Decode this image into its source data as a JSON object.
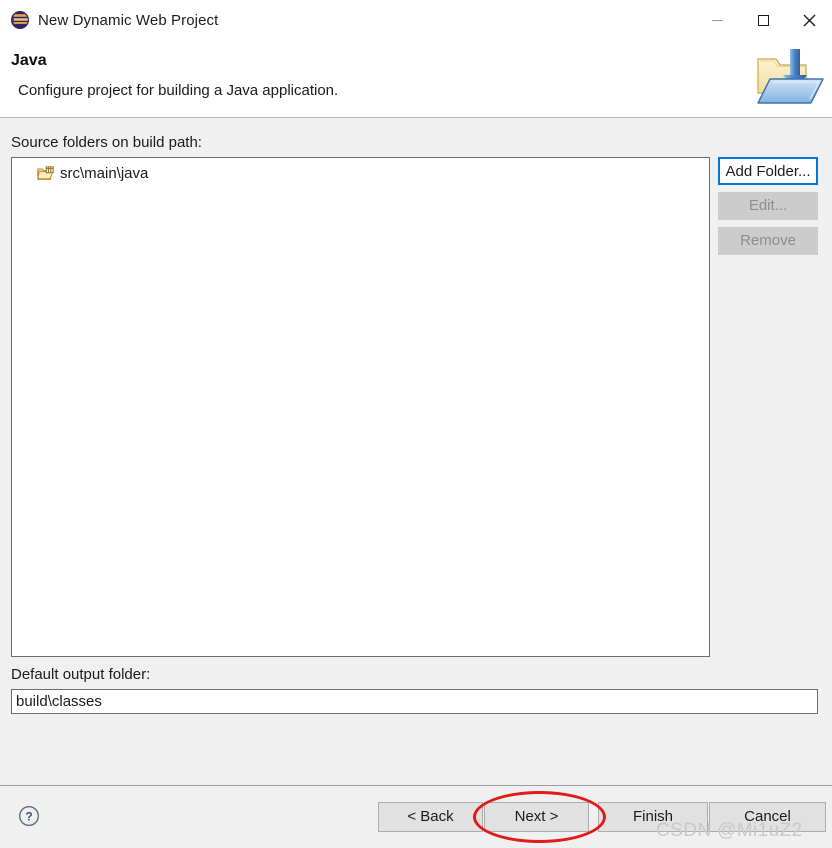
{
  "window": {
    "title": "New Dynamic Web Project",
    "app_icon": "eclipse-icon",
    "controls": {
      "minimize": "minimize-icon",
      "maximize": "maximize-icon",
      "close": "close-icon"
    }
  },
  "header": {
    "title": "Java",
    "description": "Configure project for building a Java application.",
    "banner_icon": "folder-import-icon"
  },
  "main": {
    "source_folders_label": "Source folders on build path:",
    "source_folders": [
      {
        "label": "src\\main\\java",
        "icon": "source-folder-icon"
      }
    ],
    "side_buttons": [
      {
        "label": "Add Folder...",
        "state": "focused"
      },
      {
        "label": "Edit...",
        "state": "disabled"
      },
      {
        "label": "Remove",
        "state": "disabled"
      }
    ],
    "output_folder_label": "Default output folder:",
    "output_folder_value": "build\\classes"
  },
  "footer": {
    "help_icon": "help-icon",
    "buttons": [
      {
        "label": "< Back",
        "name": "back-button"
      },
      {
        "label": "Next >",
        "name": "next-button"
      },
      {
        "label": "Finish",
        "name": "finish-button"
      },
      {
        "label": "Cancel",
        "name": "cancel-button"
      }
    ]
  },
  "annotation": {
    "shape": "red-ellipse",
    "target": "Next >",
    "color": "#e01b18"
  },
  "watermark": {
    "text": "CSDN @Mi1uZ2",
    "color": "#c9c9c9"
  },
  "colors": {
    "accent": "#0078d7",
    "dialog_bg": "#f0f0f0",
    "panel_bg": "#ffffff",
    "annotation": "#e01b18"
  }
}
